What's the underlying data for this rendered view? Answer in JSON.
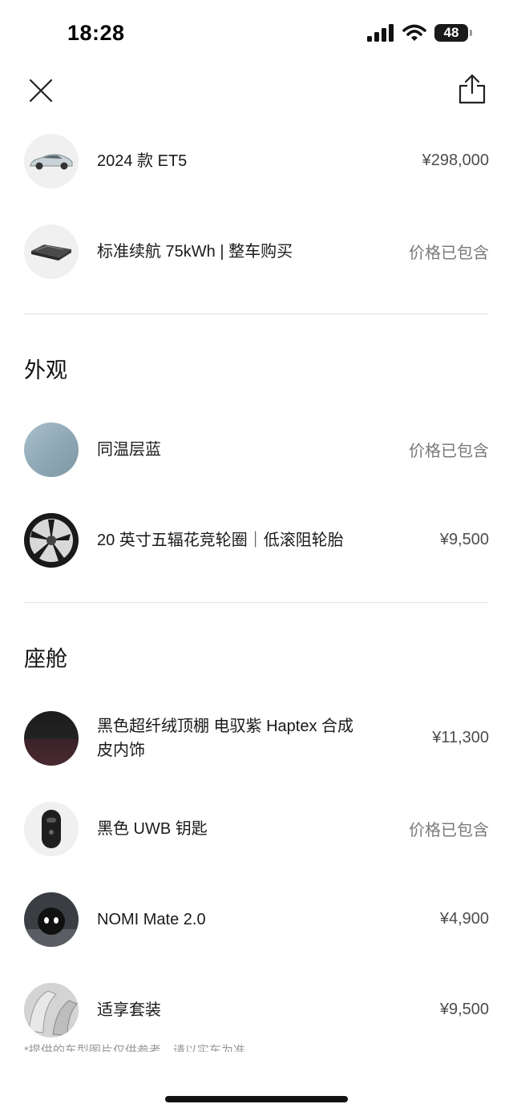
{
  "status_bar": {
    "time": "18:28",
    "battery_level": "48"
  },
  "vehicle": [
    {
      "name": "2024 款 ET5",
      "price": "¥298,000",
      "icon": "car-thumbnail"
    },
    {
      "name": "标准续航 75kWh | 整车购买",
      "price": "价格已包含",
      "icon": "battery-pack-thumbnail"
    }
  ],
  "exterior": {
    "title": "外观",
    "items": [
      {
        "name": "同温层蓝",
        "price": "价格已包含",
        "icon": "paint-color-swatch"
      },
      {
        "name": "20 英寸五辐花竞轮圈｜低滚阻轮胎",
        "price": "¥9,500",
        "icon": "wheel-thumbnail"
      }
    ]
  },
  "cabin": {
    "title": "座舱",
    "items": [
      {
        "name": "黑色超纤绒顶棚 电驭紫 Haptex 合成皮内饰",
        "price": "¥11,300",
        "icon": "interior-swatch"
      },
      {
        "name": "黑色 UWB 钥匙",
        "price": "价格已包含",
        "icon": "key-fob-thumbnail"
      },
      {
        "name": "NOMI Mate 2.0",
        "price": "¥4,900",
        "icon": "nomi-thumbnail"
      },
      {
        "name": "适享套装",
        "price": "¥9,500",
        "icon": "seat-thumbnail"
      }
    ]
  },
  "disclaimer": "*提供的车型图片仅供参考，请以实车为准"
}
